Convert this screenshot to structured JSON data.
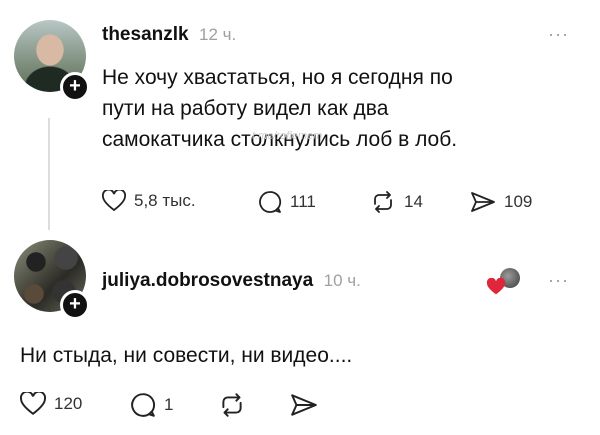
{
  "posts": [
    {
      "username": "thesanzlk",
      "time": "12 ч.",
      "text_lines": [
        "Не хочу хвастаться, но я сегодня по",
        "пути на работу видел как два",
        "самокатчика столкнулись лоб в лоб."
      ],
      "likes": "5,8 тыс.",
      "comments": "111",
      "reposts": "14",
      "shares": "109",
      "more": "···"
    },
    {
      "username": "juliya.dobrosovestnaya",
      "time": "10 ч.",
      "text": "Ни стыда, ни совести, ни видео....",
      "likes": "120",
      "comments": "1",
      "more": "···"
    }
  ],
  "watermark": "t.me/roflemem",
  "icons": {
    "heart": "heart-icon",
    "comment": "comment-icon",
    "repost": "repost-icon",
    "share": "share-icon",
    "plus": "plus-icon",
    "more": "more-icon"
  }
}
